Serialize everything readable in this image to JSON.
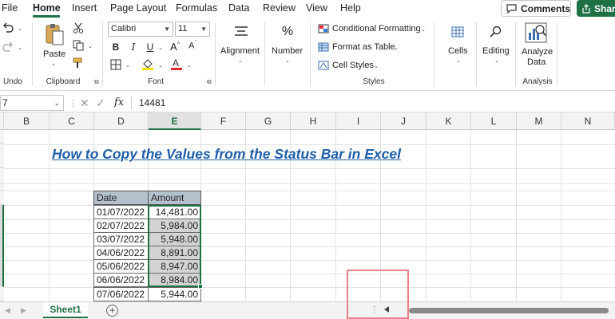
{
  "menu": {
    "items": [
      "File",
      "Home",
      "Insert",
      "Page Layout",
      "Formulas",
      "Data",
      "Review",
      "View",
      "Help"
    ],
    "active": "Home",
    "comments_label": "Comments",
    "share_label": "Share"
  },
  "ribbon": {
    "undo": {
      "group_label": "Undo"
    },
    "clipboard": {
      "paste_label": "Paste",
      "group_label": "Clipboard"
    },
    "font": {
      "font_name": "Calibri",
      "font_size": "11",
      "bold": "B",
      "italic": "I",
      "underline": "U",
      "group_label": "Font"
    },
    "alignment": {
      "label": "Alignment"
    },
    "number": {
      "label": "Number"
    },
    "styles": {
      "conditional_formatting": "Conditional Formatting",
      "format_as_table": "Format as Table",
      "cell_styles": "Cell Styles",
      "group_label": "Styles"
    },
    "cells": {
      "label": "Cells"
    },
    "editing": {
      "label": "Editing"
    },
    "analysis": {
      "analyze_line1": "Analyze",
      "analyze_line2": "Data",
      "group_label": "Analysis"
    }
  },
  "formula_bar": {
    "name_box": "7",
    "fx": "fx",
    "value": "14481"
  },
  "columns": [
    "B",
    "C",
    "D",
    "E",
    "F",
    "G",
    "H",
    "I",
    "J",
    "K",
    "L",
    "M",
    "N"
  ],
  "selected_column": "E",
  "title": "How to Copy the Values from the Status Bar in Excel",
  "table": {
    "headers": [
      "Date",
      "Amount"
    ],
    "rows": [
      {
        "date": "01/07/2022",
        "amount": "14,481.00"
      },
      {
        "date": "02/07/2022",
        "amount": "5,984.00"
      },
      {
        "date": "03/07/2022",
        "amount": "5,948.00"
      },
      {
        "date": "04/06/2022",
        "amount": "8,891.00"
      },
      {
        "date": "05/06/2022",
        "amount": "8,947.00"
      },
      {
        "date": "06/06/2022",
        "amount": "8,984.00"
      },
      {
        "date": "07/06/2022",
        "amount": "5,944.00"
      }
    ]
  },
  "sheet_tabs": {
    "active": "Sheet1"
  },
  "colors": {
    "accent": "#1e7145",
    "title": "#1f5ea8",
    "highlight_box": "#e8808a"
  }
}
